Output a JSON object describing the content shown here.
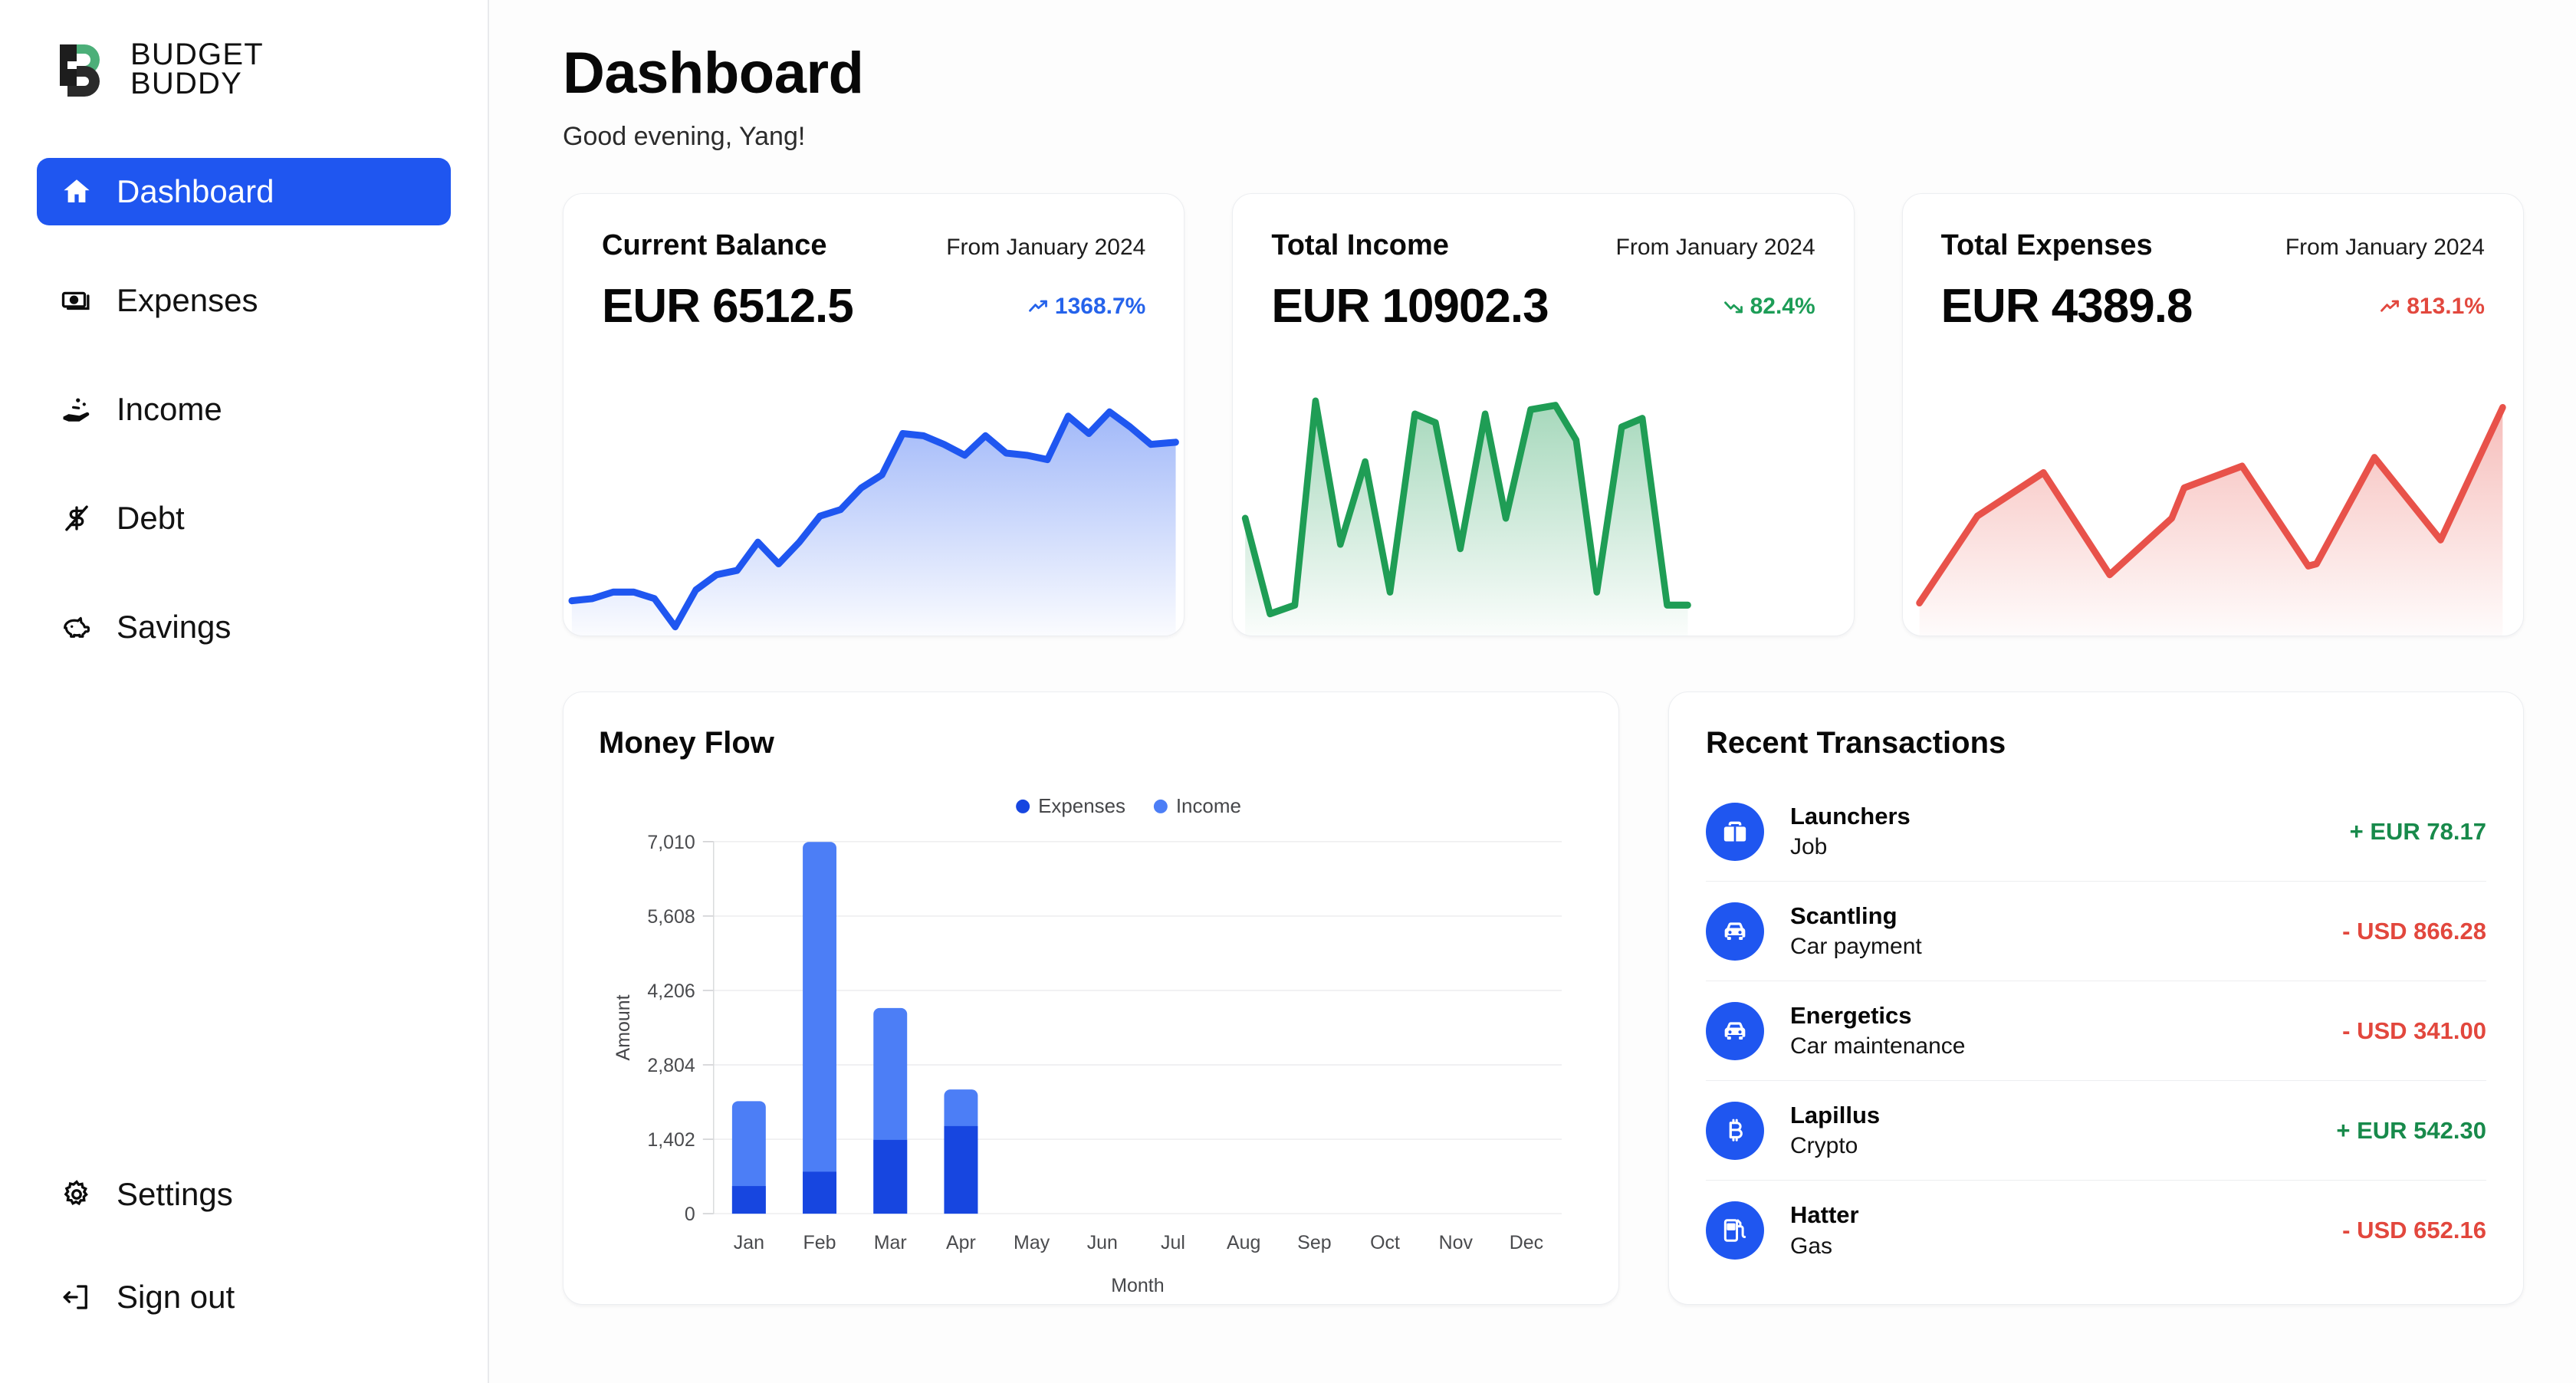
{
  "brand": {
    "line1": "BUDGET",
    "line2": "BUDDY",
    "mark_dark": "#1d1d1d",
    "mark_green": "#4caf79"
  },
  "sidebar": {
    "items": [
      {
        "label": "Dashboard",
        "icon": "home-icon",
        "active": true
      },
      {
        "label": "Expenses",
        "icon": "banknote-icon",
        "active": false
      },
      {
        "label": "Income",
        "icon": "hand-coins-icon",
        "active": false
      },
      {
        "label": "Debt",
        "icon": "dollar-slash-icon",
        "active": false
      },
      {
        "label": "Savings",
        "icon": "piggy-bank-icon",
        "active": false
      }
    ],
    "bottom_items": [
      {
        "label": "Settings",
        "icon": "gear-icon"
      },
      {
        "label": "Sign out",
        "icon": "logout-icon"
      }
    ],
    "active_bg": "#1f56f0"
  },
  "header": {
    "title": "Dashboard",
    "greeting": "Good evening, Yang!"
  },
  "stats": [
    {
      "label": "Current Balance",
      "period": "From January 2024",
      "value": "EUR 6512.5",
      "delta": "1368.7%",
      "delta_color": "#2563eb",
      "trend": "up",
      "accent": "#1f56f0"
    },
    {
      "label": "Total Income",
      "period": "From January 2024",
      "value": "EUR 10902.3",
      "delta": "82.4%",
      "delta_color": "#1d9d57",
      "trend": "down",
      "accent": "#1f9d55"
    },
    {
      "label": "Total Expenses",
      "period": "From January 2024",
      "value": "EUR 4389.8",
      "delta": "813.1%",
      "delta_color": "#e2483e",
      "trend": "up",
      "accent": "#e8524a"
    }
  ],
  "money_flow": {
    "title": "Money Flow"
  },
  "chart_data": {
    "type": "bar",
    "title": "Money Flow",
    "stacked": true,
    "xlabel": "Month",
    "ylabel": "Amount",
    "categories": [
      "Jan",
      "Feb",
      "Mar",
      "Apr",
      "May",
      "Jun",
      "Jul",
      "Aug",
      "Sep",
      "Oct",
      "Nov",
      "Dec"
    ],
    "yticks": [
      0,
      1402,
      2804,
      4206,
      5608,
      7010
    ],
    "ylim": [
      0,
      7010
    ],
    "grid": true,
    "legend_position": "top-center",
    "series": [
      {
        "name": "Expenses",
        "color": "#1746e0",
        "values": [
          520,
          790,
          1390,
          1650,
          0,
          0,
          0,
          0,
          0,
          0,
          0,
          0
        ]
      },
      {
        "name": "Income",
        "color": "#4c7ef6",
        "values": [
          1600,
          6215,
          2485,
          690,
          0,
          0,
          0,
          0,
          0,
          0,
          0,
          0
        ]
      }
    ]
  },
  "transactions": {
    "title": "Recent Transactions",
    "rows": [
      {
        "name": "Launchers",
        "category": "Job",
        "amount": "+ EUR 78.17",
        "sign": "pos",
        "icon": "briefcase-icon"
      },
      {
        "name": "Scantling",
        "category": "Car payment",
        "amount": "- USD 866.28",
        "sign": "neg",
        "icon": "car-icon"
      },
      {
        "name": "Energetics",
        "category": "Car maintenance",
        "amount": "- USD 341.00",
        "sign": "neg",
        "icon": "car-icon"
      },
      {
        "name": "Lapillus",
        "category": "Crypto",
        "amount": "+ EUR 542.30",
        "sign": "pos",
        "icon": "bitcoin-icon"
      },
      {
        "name": "Hatter",
        "category": "Gas",
        "amount": "- USD 652.16",
        "sign": "neg",
        "icon": "fuel-icon"
      }
    ]
  }
}
